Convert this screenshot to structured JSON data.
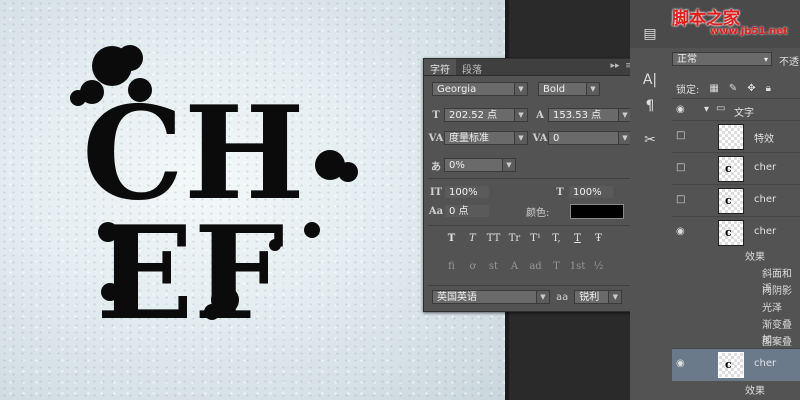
{
  "canvas": {
    "art_line1": "CH",
    "art_line2": "EF"
  },
  "character_panel": {
    "tab_character": "字符",
    "tab_paragraph": "段落",
    "font_family": "Georgia",
    "font_style": "Bold",
    "font_size": "202.52 点",
    "leading": "153.53 点",
    "kerning": "度量标准",
    "tracking": "0",
    "tsume": "0%",
    "vertical_scale": "100%",
    "horizontal_scale": "100%",
    "baseline_shift": "0 点",
    "color_label": "颜色:",
    "language": "英国英语",
    "aa_label": "aa",
    "antialias": "锐利",
    "style_buttons": [
      "T",
      "T",
      "TT",
      "Tr",
      "T¹",
      "T,",
      "T",
      "Ŧ"
    ]
  },
  "layers_panel": {
    "blend_mode": "正常",
    "opacity_label": "不透",
    "lock_label": "锁定:",
    "layers": [
      {
        "name": "文字",
        "type": "group"
      },
      {
        "name": "特效",
        "type": "layer"
      },
      {
        "name": "cher",
        "type": "layer"
      },
      {
        "name": "cher",
        "type": "layer"
      },
      {
        "name": "cher",
        "type": "layer"
      },
      {
        "name": "cher",
        "type": "layer"
      }
    ],
    "effects_label": "效果",
    "effects": [
      "斜面和浮",
      "内阴影",
      "光泽",
      "渐变叠加",
      "图案叠加"
    ],
    "effects_label_2": "效果"
  },
  "watermark": {
    "text": "脚本之家",
    "url": "www.jb51.net"
  },
  "colors": {
    "canvas_bg": "#e6eef1",
    "panel_bg": "#535353",
    "text_fill": "#0b0b0b",
    "watermark": "#e61c1c"
  }
}
